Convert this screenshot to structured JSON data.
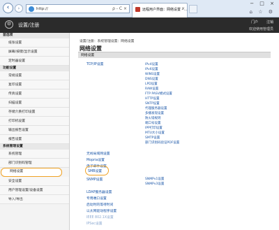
{
  "browser": {
    "url": "http://",
    "addr_tools": "ρ - C ×",
    "tab_title": "远程用户界面：网络设置 - ...",
    "tab_close": "×",
    "window_buttons": "− □ ×",
    "chrome_icons": "⌂ ☆ ⚙"
  },
  "header": {
    "app_title": "设置/注册",
    "portal": "门户",
    "logout": "注销",
    "user": "欢迎使用管理员"
  },
  "sidebar": {
    "sections": [
      {
        "title": "首选项",
        "items": [
          "纸张设置",
          "屏幕/按键/显示设置",
          "定时器设置"
        ]
      },
      {
        "title": "功能设置",
        "items": [
          "常规设置",
          "复印设置",
          "传真设置",
          "扫描设置",
          "存储介质打印设置",
          "打印机设置",
          "输出报告设置",
          "报告设置"
        ]
      },
      {
        "title": "系统管理设置",
        "items": [
          "系统管理",
          "部门识别码管理",
          "网络设置",
          "安全设置",
          "用户管理设置/设备设置",
          "导入/导出"
        ]
      }
    ],
    "active_item": "网络设置"
  },
  "main": {
    "breadcrumb": "设置/注册：系统管理设置：网络设置",
    "title": "网络设置",
    "table_header": "网络设置",
    "left_links": [
      "TCP/IP设置",
      "无线局域网设置",
      "Mopria设置",
      "电子邮件设置",
      "SMB设置",
      "SNMP设置",
      "LDAP服务器设置",
      "专用端口设置",
      "启动时的等待时间",
      "以太网驱动程序设置",
      "IEEE 802.1X设置",
      "IPSec设置"
    ],
    "tcpip_sub": [
      "IPv4设置",
      "IPv6设置",
      "WINS设置",
      "DNS设置",
      "LPD设置",
      "RAW设置",
      "FTP PASV模式设置",
      "HTTP设置",
      "SNTP设置",
      "代理服务器设置",
      "多播发现设置",
      "防火墙规则",
      "端口号设置",
      "IPP打印设置",
      "MTU大小设置",
      "SMTP设置",
      "部门识别码验证PDF设置"
    ],
    "snmp_sub": [
      "SNMPv1设置",
      "SNMPv3设置"
    ]
  }
}
